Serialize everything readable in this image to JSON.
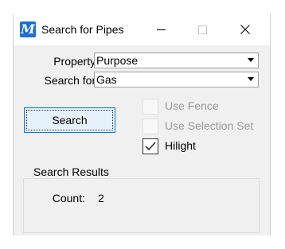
{
  "window": {
    "title": "Search for Pipes",
    "icon": "microstation-icon",
    "icon_glyph": "M"
  },
  "titlebar_controls": {
    "minimize": "minimize-icon",
    "maximize": "maximize-icon",
    "close": "close-icon"
  },
  "form": {
    "property_label": "Property:",
    "property_value": "Purpose",
    "search_for_label": "Search for:",
    "search_for_value": "Gas"
  },
  "search_button_label": "Search",
  "options": [
    {
      "label": "Use Fence",
      "checked": false,
      "enabled": false
    },
    {
      "label": "Use Selection Set",
      "checked": false,
      "enabled": false
    },
    {
      "label": "Hilight",
      "checked": true,
      "enabled": true
    }
  ],
  "results": {
    "group_title": "Search Results",
    "count_label": "Count:",
    "count_value": "2"
  },
  "colors": {
    "accent": "#0078d7",
    "app_icon": "#1c6fd1",
    "disabled_text": "#9a9a9a",
    "dialog_bg": "#f0f0f0"
  }
}
